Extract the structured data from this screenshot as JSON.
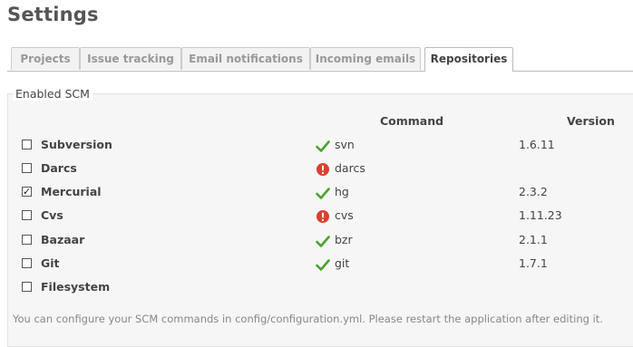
{
  "page": {
    "title": "Settings"
  },
  "tabs": [
    {
      "label": "Projects",
      "active": false
    },
    {
      "label": "Issue tracking",
      "active": false
    },
    {
      "label": "Email notifications",
      "active": false
    },
    {
      "label": "Incoming emails",
      "active": false
    },
    {
      "label": "Repositories",
      "active": true
    }
  ],
  "scm": {
    "legend": "Enabled SCM",
    "columns": {
      "command": "Command",
      "version": "Version"
    },
    "rows": [
      {
        "name": "Subversion",
        "checked": false,
        "status": "ok",
        "status_icon": "check-icon",
        "command": "svn",
        "version": "1.6.11"
      },
      {
        "name": "Darcs",
        "checked": false,
        "status": "error",
        "status_icon": "error-icon",
        "command": "darcs",
        "version": ""
      },
      {
        "name": "Mercurial",
        "checked": true,
        "status": "ok",
        "status_icon": "check-icon",
        "command": "hg",
        "version": "2.3.2"
      },
      {
        "name": "Cvs",
        "checked": false,
        "status": "error",
        "status_icon": "error-icon",
        "command": "cvs",
        "version": "1.11.23"
      },
      {
        "name": "Bazaar",
        "checked": false,
        "status": "ok",
        "status_icon": "check-icon",
        "command": "bzr",
        "version": "2.1.1"
      },
      {
        "name": "Git",
        "checked": false,
        "status": "ok",
        "status_icon": "check-icon",
        "command": "git",
        "version": "1.7.1"
      },
      {
        "name": "Filesystem",
        "checked": false,
        "status": "none",
        "status_icon": "",
        "command": "",
        "version": ""
      }
    ],
    "note": "You can configure your SCM commands in config/configuration.yml. Please restart the application after editing it."
  },
  "colors": {
    "ok": "#4aa32d",
    "error": "#d9412f",
    "panel_bg": "#f6f6f6"
  }
}
